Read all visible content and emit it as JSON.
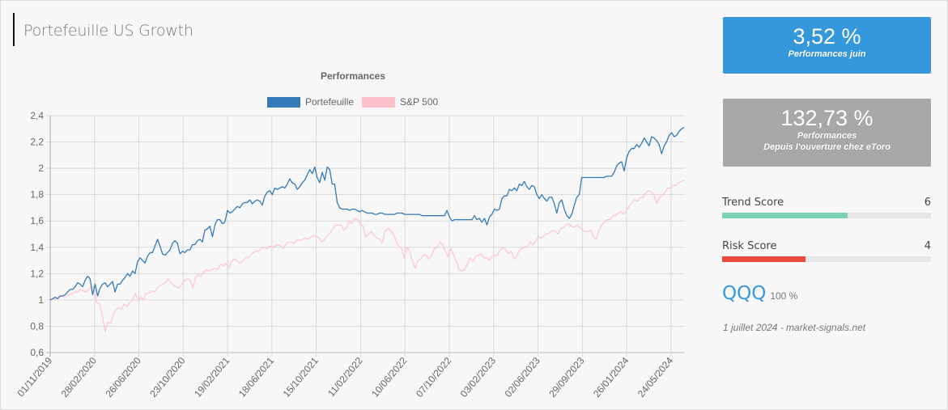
{
  "page": {
    "title": "Portefeuille US Growth"
  },
  "cards": [
    {
      "value": "3,52 %",
      "label": "Performances juin",
      "color": "#3598dc"
    },
    {
      "value": "132,73 %",
      "label_line1": "Performances",
      "label_line2": "Depuis l'ouverture chez eToro",
      "color": "#a8a8a8"
    }
  ],
  "scores": [
    {
      "label": "Trend Score",
      "value": "6",
      "fraction": 0.6,
      "color": "#7bd3b4"
    },
    {
      "label": "Risk Score",
      "value": "4",
      "fraction": 0.4,
      "color": "#e74c3c"
    }
  ],
  "holding": {
    "symbol": "QQQ",
    "weight": "100 %"
  },
  "footer": "1 juillet 2024 - market-signals.net",
  "chart_data": {
    "type": "line",
    "title": "Performances",
    "xlabel": "",
    "ylabel": "",
    "ylim": [
      0.6,
      2.4
    ],
    "yticks": [
      "2,4",
      "2,2",
      "2",
      "1,8",
      "1,6",
      "1,4",
      "1,2",
      "1",
      "0,8",
      "0,6"
    ],
    "ytick_values": [
      2.4,
      2.2,
      2.0,
      1.8,
      1.6,
      1.4,
      1.2,
      1.0,
      0.8,
      0.6
    ],
    "xticks": [
      "01/11/2019",
      "28/02/2020",
      "26/06/2020",
      "23/10/2020",
      "19/02/2021",
      "18/06/2021",
      "15/10/2021",
      "11/02/2022",
      "10/06/2022",
      "07/10/2022",
      "03/02/2023",
      "02/06/2023",
      "29/09/2023",
      "26/01/2024",
      "24/05/2024"
    ],
    "x_start": "01/11/2019",
    "x_end": "28/06/2024",
    "grid": true,
    "legend_position": "top",
    "series": [
      {
        "name": "Portefeuille",
        "color": "#337ab7",
        "values": [
          1.0,
          1.01,
          1.02,
          1.01,
          1.03,
          1.03,
          1.04,
          1.06,
          1.08,
          1.08,
          1.1,
          1.13,
          1.12,
          1.1,
          1.15,
          1.18,
          1.16,
          1.04,
          1.12,
          1.03,
          1.09,
          1.12,
          1.13,
          1.1,
          1.12,
          1.14,
          1.06,
          1.12,
          1.12,
          1.15,
          1.17,
          1.2,
          1.18,
          1.22,
          1.2,
          1.29,
          1.32,
          1.3,
          1.28,
          1.33,
          1.36,
          1.36,
          1.41,
          1.46,
          1.41,
          1.35,
          1.34,
          1.36,
          1.38,
          1.43,
          1.45,
          1.43,
          1.35,
          1.37,
          1.36,
          1.38,
          1.38,
          1.42,
          1.42,
          1.45,
          1.46,
          1.44,
          1.53,
          1.54,
          1.56,
          1.48,
          1.57,
          1.61,
          1.61,
          1.58,
          1.59,
          1.68,
          1.66,
          1.67,
          1.69,
          1.71,
          1.7,
          1.73,
          1.74,
          1.74,
          1.76,
          1.73,
          1.75,
          1.76,
          1.75,
          1.72,
          1.79,
          1.82,
          1.83,
          1.8,
          1.85,
          1.84,
          1.85,
          1.86,
          1.85,
          1.88,
          1.92,
          1.89,
          1.88,
          1.84,
          1.86,
          1.89,
          1.91,
          1.95,
          1.99,
          1.96,
          2.01,
          1.93,
          1.89,
          1.97,
          1.91,
          2.01,
          1.99,
          1.88,
          1.88,
          1.74,
          1.7,
          1.69,
          1.69,
          1.69,
          1.68,
          1.69,
          1.69,
          1.68,
          1.67,
          1.68,
          1.67,
          1.66,
          1.66,
          1.66,
          1.65,
          1.65,
          1.66,
          1.66,
          1.65,
          1.65,
          1.65,
          1.65,
          1.65,
          1.66,
          1.66,
          1.66,
          1.65,
          1.65,
          1.65,
          1.65,
          1.65,
          1.65,
          1.65,
          1.64,
          1.64,
          1.64,
          1.64,
          1.64,
          1.64,
          1.64,
          1.64,
          1.64,
          1.64,
          1.68,
          1.63,
          1.6,
          1.61,
          1.61,
          1.61,
          1.61,
          1.61,
          1.61,
          1.61,
          1.61,
          1.64,
          1.61,
          1.62,
          1.59,
          1.62,
          1.57,
          1.63,
          1.65,
          1.69,
          1.68,
          1.69,
          1.77,
          1.79,
          1.79,
          1.84,
          1.83,
          1.85,
          1.83,
          1.88,
          1.87,
          1.9,
          1.86,
          1.84,
          1.87,
          1.86,
          1.8,
          1.77,
          1.8,
          1.77,
          1.75,
          1.78,
          1.78,
          1.73,
          1.66,
          1.74,
          1.76,
          1.69,
          1.64,
          1.62,
          1.65,
          1.72,
          1.78,
          1.8,
          1.93,
          1.93,
          1.93,
          1.93,
          1.93,
          1.93,
          1.93,
          1.93,
          1.93,
          1.93,
          1.94,
          1.94,
          1.94,
          1.97,
          2.02,
          2.04,
          2.05,
          1.98,
          2.08,
          2.13,
          2.15,
          2.15,
          2.18,
          2.16,
          2.19,
          2.23,
          2.2,
          2.17,
          2.24,
          2.23,
          2.21,
          2.18,
          2.11,
          2.17,
          2.2,
          2.25,
          2.27,
          2.24,
          2.25,
          2.28,
          2.3,
          2.31
        ]
      },
      {
        "name": "S&P 500",
        "color": "#ffc0cb",
        "values": [
          1.0,
          1.01,
          1.01,
          1.02,
          1.03,
          1.02,
          1.03,
          1.04,
          1.05,
          1.06,
          1.06,
          1.08,
          1.07,
          1.06,
          1.08,
          1.1,
          1.09,
          0.98,
          0.97,
          0.88,
          0.76,
          0.83,
          0.82,
          0.89,
          0.93,
          0.94,
          0.93,
          0.97,
          0.95,
          0.98,
          1.0,
          1.05,
          1.0,
          1.02,
          1.0,
          1.05,
          1.05,
          1.07,
          1.06,
          1.09,
          1.11,
          1.12,
          1.13,
          1.16,
          1.13,
          1.11,
          1.1,
          1.09,
          1.12,
          1.15,
          1.16,
          1.15,
          1.09,
          1.17,
          1.19,
          1.18,
          1.21,
          1.23,
          1.22,
          1.23,
          1.24,
          1.23,
          1.27,
          1.26,
          1.28,
          1.24,
          1.29,
          1.31,
          1.3,
          1.28,
          1.29,
          1.32,
          1.32,
          1.34,
          1.36,
          1.37,
          1.37,
          1.39,
          1.4,
          1.39,
          1.41,
          1.4,
          1.41,
          1.42,
          1.41,
          1.39,
          1.43,
          1.44,
          1.44,
          1.43,
          1.46,
          1.45,
          1.46,
          1.47,
          1.46,
          1.48,
          1.49,
          1.48,
          1.47,
          1.44,
          1.46,
          1.49,
          1.51,
          1.54,
          1.57,
          1.57,
          1.57,
          1.53,
          1.55,
          1.6,
          1.58,
          1.62,
          1.61,
          1.58,
          1.56,
          1.48,
          1.5,
          1.52,
          1.49,
          1.47,
          1.46,
          1.43,
          1.52,
          1.54,
          1.53,
          1.5,
          1.45,
          1.41,
          1.39,
          1.32,
          1.4,
          1.37,
          1.3,
          1.24,
          1.3,
          1.31,
          1.34,
          1.34,
          1.31,
          1.34,
          1.39,
          1.4,
          1.44,
          1.42,
          1.37,
          1.33,
          1.39,
          1.34,
          1.29,
          1.23,
          1.22,
          1.23,
          1.27,
          1.32,
          1.29,
          1.33,
          1.34,
          1.35,
          1.32,
          1.32,
          1.3,
          1.33,
          1.34,
          1.34,
          1.38,
          1.4,
          1.38,
          1.35,
          1.37,
          1.31,
          1.33,
          1.38,
          1.39,
          1.4,
          1.41,
          1.44,
          1.42,
          1.45,
          1.48,
          1.47,
          1.49,
          1.5,
          1.51,
          1.53,
          1.52,
          1.5,
          1.54,
          1.55,
          1.57,
          1.58,
          1.56,
          1.55,
          1.57,
          1.55,
          1.53,
          1.52,
          1.52,
          1.53,
          1.48,
          1.46,
          1.53,
          1.57,
          1.59,
          1.61,
          1.61,
          1.64,
          1.64,
          1.66,
          1.67,
          1.65,
          1.68,
          1.71,
          1.74,
          1.76,
          1.75,
          1.78,
          1.78,
          1.81,
          1.83,
          1.82,
          1.8,
          1.73,
          1.78,
          1.79,
          1.82,
          1.85,
          1.85,
          1.87,
          1.87,
          1.89,
          1.9,
          1.91
        ]
      }
    ]
  }
}
